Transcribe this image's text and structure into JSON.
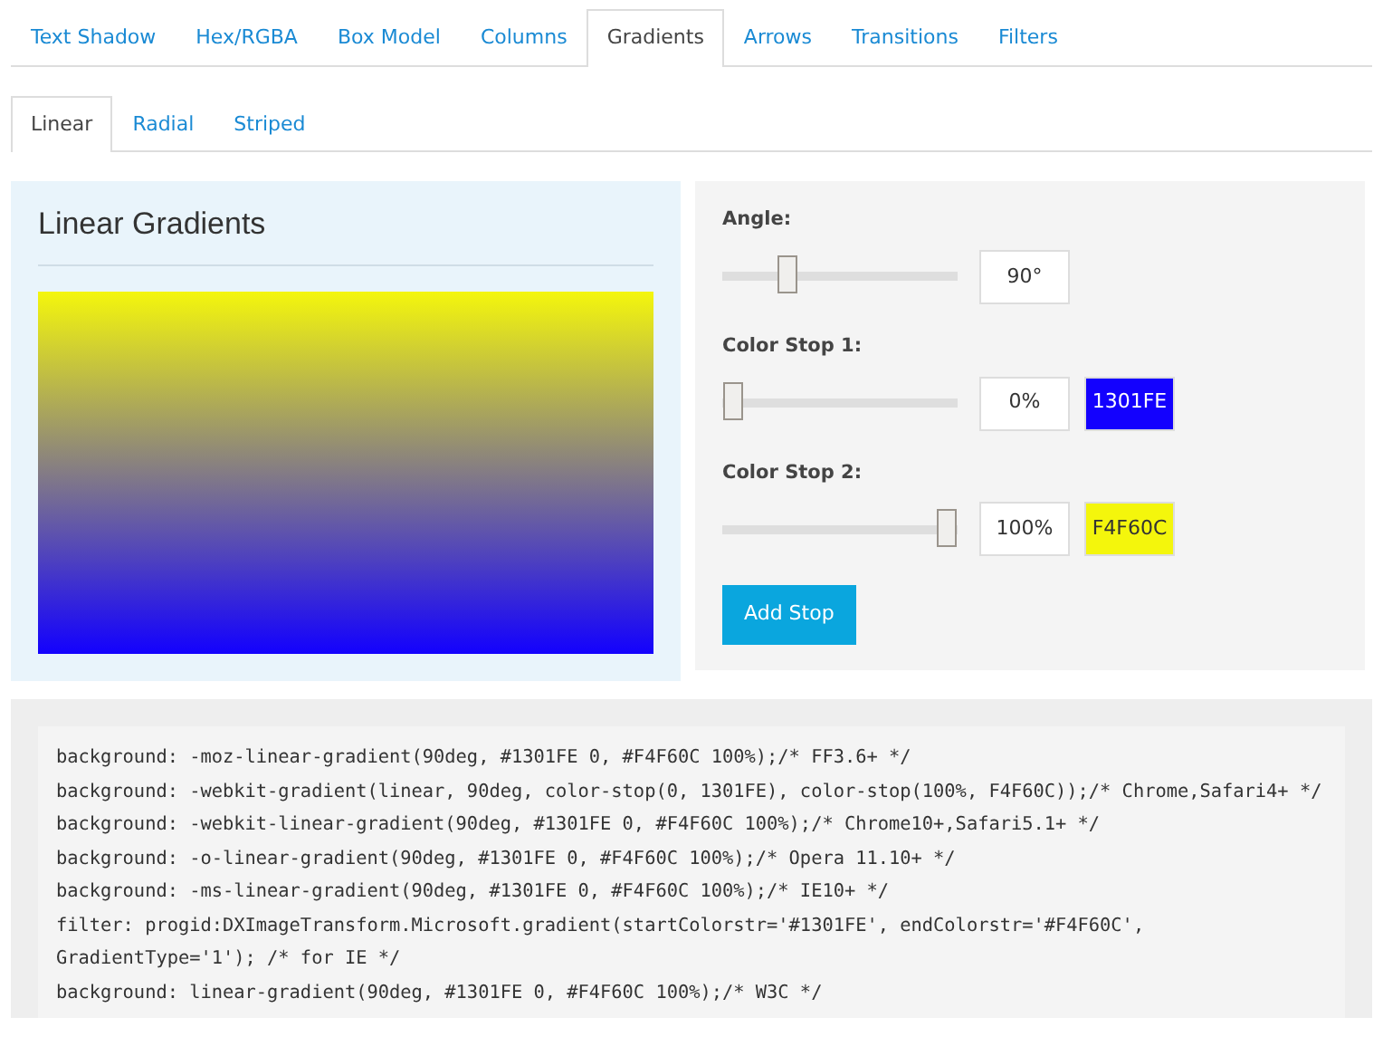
{
  "tabs": [
    {
      "label": "Text Shadow",
      "selected": false
    },
    {
      "label": "Hex/RGBA",
      "selected": false
    },
    {
      "label": "Box Model",
      "selected": false
    },
    {
      "label": "Columns",
      "selected": false
    },
    {
      "label": "Gradients",
      "selected": true
    },
    {
      "label": "Arrows",
      "selected": false
    },
    {
      "label": "Transitions",
      "selected": false
    },
    {
      "label": "Filters",
      "selected": false
    }
  ],
  "subtabs": [
    {
      "label": "Linear",
      "selected": true
    },
    {
      "label": "Radial",
      "selected": false
    },
    {
      "label": "Striped",
      "selected": false
    }
  ],
  "preview": {
    "title": "Linear Gradients"
  },
  "controls": [
    {
      "label": "Angle:",
      "level": 0.25,
      "value": "90°"
    },
    {
      "label": "Color Stop 1:",
      "level": 0,
      "value": "0%",
      "swatch": "1301FE",
      "color": "#1301fe"
    },
    {
      "label": "Color Stop 2:",
      "level": 1,
      "value": "100%",
      "swatch": "F4F60C",
      "color": "#f4f60c"
    }
  ],
  "add_button": "Add Stop",
  "code_lines": [
    "background: -moz-linear-gradient(90deg, #1301FE 0, #F4F60C 100%);/* FF3.6+ */",
    "background: -webkit-gradient(linear, 90deg, color-stop(0, 1301FE), color-stop(100%, F4F60C));/* Chrome,Safari4+ */",
    "background: -webkit-linear-gradient(90deg, #1301FE 0, #F4F60C 100%);/* Chrome10+,Safari5.1+ */",
    "background: -o-linear-gradient(90deg, #1301FE 0, #F4F60C 100%);/* Opera 11.10+ */",
    "background: -ms-linear-gradient(90deg, #1301FE 0, #F4F60C 100%);/* IE10+ */",
    "filter: progid:DXImageTransform.Microsoft.gradient(startColorstr='#1301FE', endColorstr='#F4F60C', GradientType='1'); /* for IE */",
    "background: linear-gradient(90deg, #1301FE 0, #F4F60C 100%);/* W3C */"
  ]
}
